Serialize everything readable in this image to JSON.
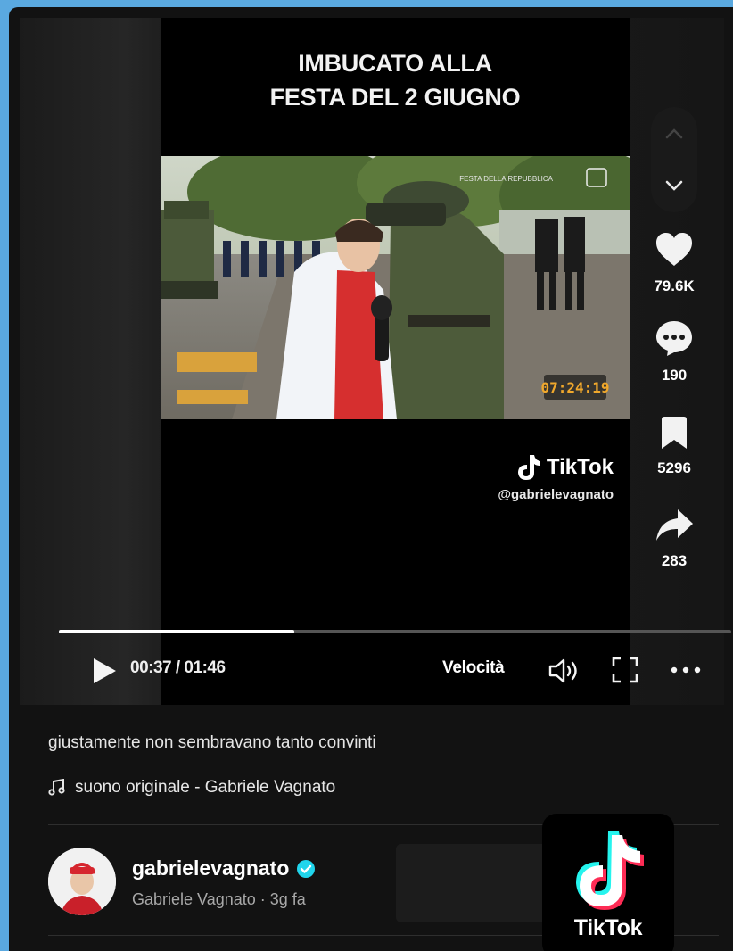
{
  "video": {
    "title_line1": "IMBUCATO ALLA",
    "title_line2": "FESTA DEL 2 GIUGNO",
    "watermark_brand": "TikTok",
    "watermark_handle": "@gabrielevagnato",
    "overlay_channel": "FESTA DELLA REPUBBLICA",
    "overlay_clock": "07:24:19",
    "progress": 0.35
  },
  "actions": {
    "likes": "79.6K",
    "comments": "190",
    "saves": "5296",
    "shares": "283"
  },
  "controls": {
    "time": "00:37 / 01:46",
    "speed_label": "Velocità"
  },
  "post": {
    "caption": "giustamente non sembravano tanto convinti",
    "music": "suono originale - Gabriele Vagnato"
  },
  "author": {
    "username": "gabrielevagnato",
    "display_name": "Gabriele Vagnato · 3g fa"
  },
  "badge": {
    "brand": "TikTok"
  },
  "icons": {
    "nav_up": "chevron-up-icon",
    "nav_down": "chevron-down-icon",
    "like": "heart-icon",
    "comment": "comment-icon",
    "save": "bookmark-icon",
    "share": "share-icon",
    "play": "play-icon",
    "volume": "volume-icon",
    "fullscreen": "fullscreen-icon",
    "more": "more-icon",
    "music": "music-note-icon",
    "verified": "verified-icon"
  },
  "colors": {
    "background": "#121212",
    "accent_verified": "#20d5ec",
    "tiktok_cyan": "#25f4ee",
    "tiktok_red": "#fe2c55"
  }
}
